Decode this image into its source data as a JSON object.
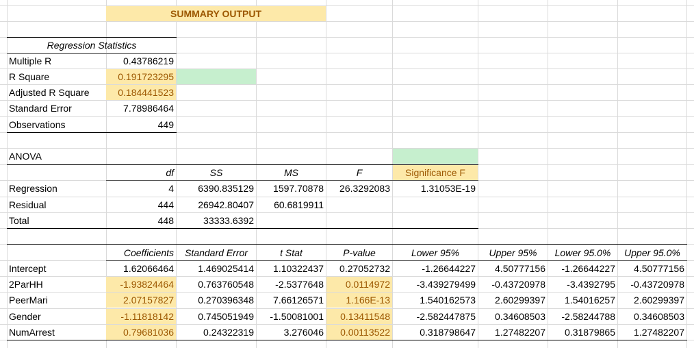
{
  "title": "SUMMARY OUTPUT",
  "regression_statistics": {
    "header": "Regression Statistics",
    "rows": [
      {
        "label": "Multiple R",
        "value": "0.43786219"
      },
      {
        "label": "R Square",
        "value": "0.191723295"
      },
      {
        "label": "Adjusted R Square",
        "value": "0.184441523"
      },
      {
        "label": "Standard Error",
        "value": "7.78986464"
      },
      {
        "label": "Observations",
        "value": "449"
      }
    ]
  },
  "anova": {
    "title": "ANOVA",
    "headers": [
      "df",
      "SS",
      "MS",
      "F",
      "Significance F"
    ],
    "rows": [
      {
        "label": "Regression",
        "df": "4",
        "ss": "6390.835129",
        "ms": "1597.70878",
        "f": "26.3292083",
        "sigf": "1.31053E-19"
      },
      {
        "label": "Residual",
        "df": "444",
        "ss": "26942.80407",
        "ms": "60.6819911",
        "f": "",
        "sigf": ""
      },
      {
        "label": "Total",
        "df": "448",
        "ss": "33333.6392",
        "ms": "",
        "f": "",
        "sigf": ""
      }
    ]
  },
  "coefficients": {
    "headers": [
      "Coefficients",
      "Standard Error",
      "t Stat",
      "P-value",
      "Lower 95%",
      "Upper 95%",
      "Lower 95.0%",
      "Upper 95.0%"
    ],
    "rows": [
      {
        "label": "Intercept",
        "values": [
          "1.62066464",
          "1.469025414",
          "1.10322437",
          "0.27052732",
          "-1.26644227",
          "4.50777156",
          "-1.26644227",
          "4.50777156"
        ]
      },
      {
        "label": "2ParHH",
        "values": [
          "-1.93824464",
          "0.763760548",
          "-2.5377648",
          "0.0114972",
          "-3.439279499",
          "-0.43720978",
          "-3.4392795",
          "-0.43720978"
        ]
      },
      {
        "label": "PeerMari",
        "values": [
          "2.07157827",
          "0.270396348",
          "7.66126571",
          "1.166E-13",
          "1.540162573",
          "2.60299397",
          "1.54016257",
          "2.60299397"
        ]
      },
      {
        "label": "Gender",
        "values": [
          "-1.11818142",
          "0.745051949",
          "-1.50081001",
          "0.13411548",
          "-2.582447875",
          "0.34608503",
          "-2.58244788",
          "0.34608503"
        ]
      },
      {
        "label": "NumArrest",
        "values": [
          "0.79681036",
          "0.24322319",
          "3.276046",
          "0.00113522",
          "0.318798647",
          "1.27482207",
          "0.31879865",
          "1.27482207"
        ]
      }
    ]
  },
  "colors": {
    "highlight_yellow": "#fde9a9",
    "highlight_green": "#c6efce",
    "highlight_text": "#9c5700",
    "gridline": "#dadada"
  }
}
